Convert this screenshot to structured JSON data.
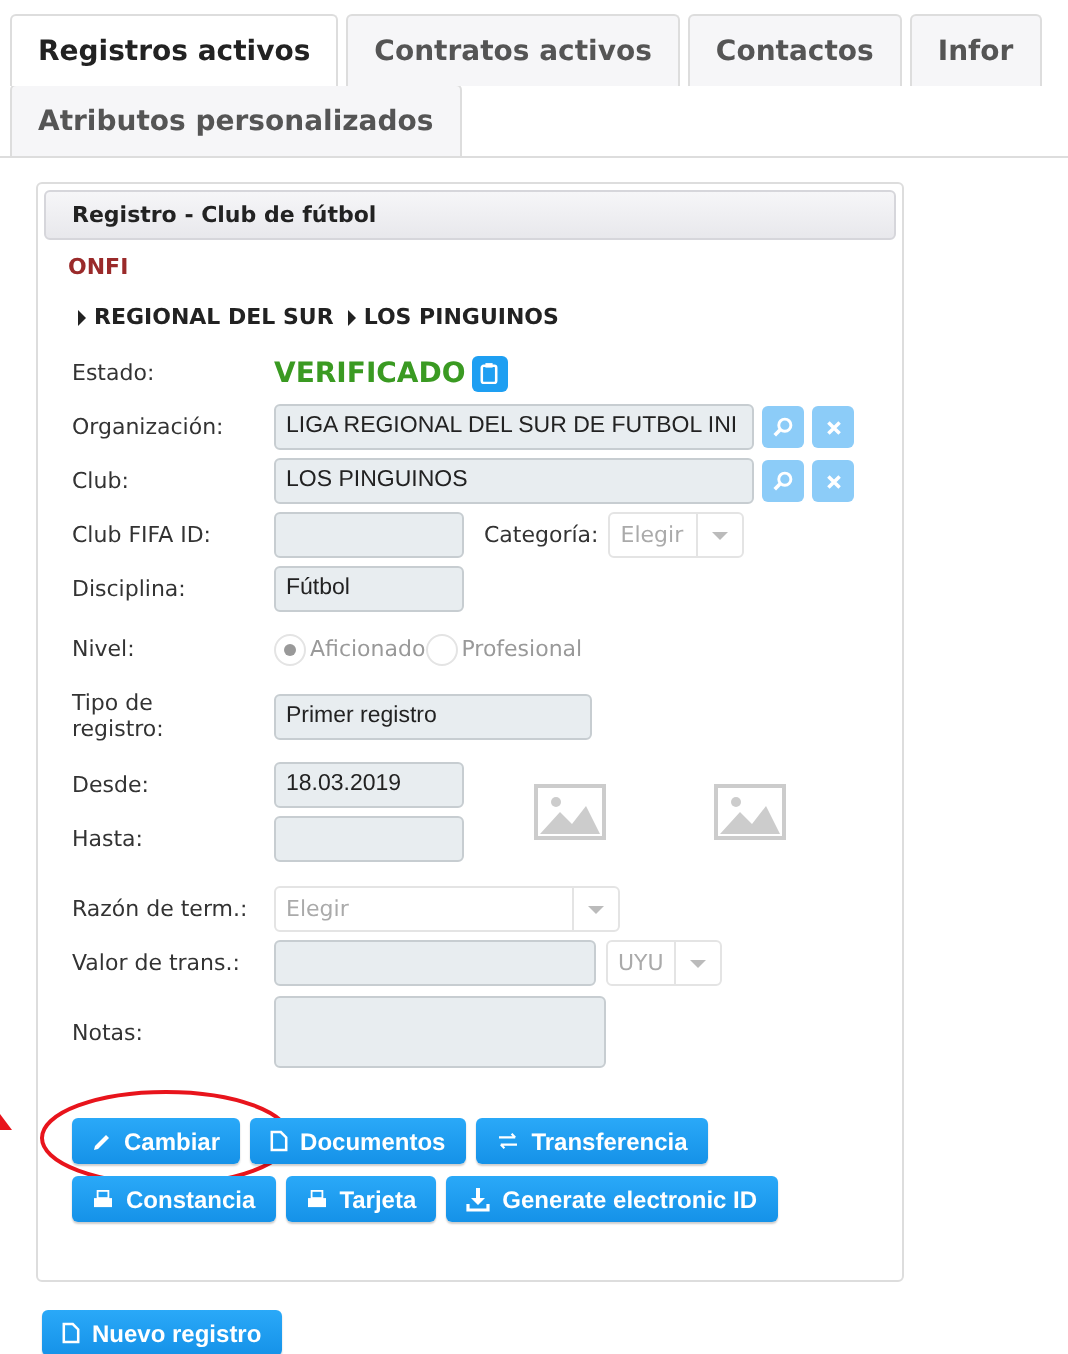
{
  "tabs": [
    {
      "label": "Registros activos",
      "selected": true
    },
    {
      "label": "Contratos activos",
      "selected": false
    },
    {
      "label": "Contactos",
      "selected": false
    },
    {
      "label": "Infor",
      "selected": false
    },
    {
      "label": "Atributos personalizados",
      "selected": false
    }
  ],
  "panel": {
    "title": "Registro - Club de fútbol",
    "organization": "ONFI",
    "breadcrumb": [
      "REGIONAL DEL SUR",
      "LOS PINGUINOS"
    ],
    "fields": [
      {
        "kind": "status",
        "label": "Estado:",
        "value": "VERIFICADO"
      },
      {
        "kind": "lookup",
        "label": "Organización:",
        "value": "LIGA REGIONAL DEL SUR DE FUTBOL INI"
      },
      {
        "kind": "lookup",
        "label": "Club:",
        "value": "LOS PINGUINOS"
      },
      {
        "kind": "text_select",
        "label": "Club FIFA ID:",
        "label2": "Categoría:",
        "select": "Elegir"
      },
      {
        "kind": "text",
        "label": "Disciplina:",
        "value": "Fútbol"
      },
      {
        "kind": "radio",
        "label": "Nivel:",
        "options": [
          {
            "label": "Aficionado",
            "selected": true
          },
          {
            "label": "Profesional",
            "selected": false
          }
        ]
      },
      {
        "kind": "wide_text",
        "label": "Tipo de registro:",
        "value": "Primer registro"
      },
      {
        "kind": "dates",
        "rows": [
          {
            "label": "Desde:",
            "value": "18.03.2019"
          },
          {
            "label": "Hasta:"
          }
        ]
      },
      {
        "kind": "select",
        "label": "Razón de term.:",
        "select": "Elegir"
      },
      {
        "kind": "currency",
        "label": "Valor de trans.:",
        "select": "UYU"
      },
      {
        "kind": "notes",
        "label": "Notas:"
      }
    ],
    "buttons": [
      {
        "label": "Cambiar",
        "highlighted": true
      },
      {
        "label": "Documentos",
        "highlighted": false
      },
      {
        "label": "Transferencia",
        "highlighted": false
      },
      {
        "label": "Constancia",
        "highlighted": false
      },
      {
        "label": "Tarjeta",
        "highlighted": false
      },
      {
        "label": "Generate electronic ID",
        "highlighted": false
      }
    ]
  },
  "new_button": {
    "label": "Nuevo registro"
  }
}
